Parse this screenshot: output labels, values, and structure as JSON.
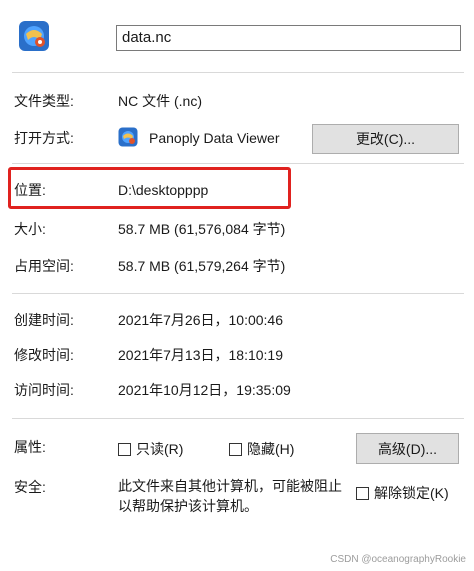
{
  "file": {
    "name": "data.nc",
    "icon": "panoply-globe-icon"
  },
  "rows": {
    "type": {
      "label": "文件类型:",
      "value": "NC 文件 (.nc)"
    },
    "opens_with": {
      "label": "打开方式:",
      "app_name": "Panoply Data Viewer",
      "app_icon": "panoply-globe-icon",
      "button": "更改(C)..."
    },
    "location": {
      "label": "位置:",
      "value": "D:\\desktopppp"
    },
    "size": {
      "label": "大小:",
      "value": "58.7 MB (61,576,084 字节)"
    },
    "size_on_disk": {
      "label": "占用空间:",
      "value": "58.7 MB (61,579,264 字节)"
    },
    "created": {
      "label": "创建时间:",
      "value": "2021年7月26日，10:00:46"
    },
    "modified": {
      "label": "修改时间:",
      "value": "2021年7月13日，18:10:19"
    },
    "accessed": {
      "label": "访问时间:",
      "value": "2021年10月12日，19:35:09"
    }
  },
  "attributes": {
    "label": "属性:",
    "readonly": {
      "label": "只读(R)",
      "checked": false
    },
    "hidden": {
      "label": "隐藏(H)",
      "checked": false
    },
    "advanced_button": "高级(D)..."
  },
  "security": {
    "label": "安全:",
    "text_line1": "此文件来自其他计算机，可能被阻止",
    "text_line2": "以帮助保护该计算机。",
    "unblock": {
      "label": "解除锁定(K)",
      "checked": false
    }
  },
  "watermark": "CSDN @oceanographyRookie",
  "colors": {
    "highlight": "#e0221f",
    "button_bg": "#e1e1e1"
  }
}
